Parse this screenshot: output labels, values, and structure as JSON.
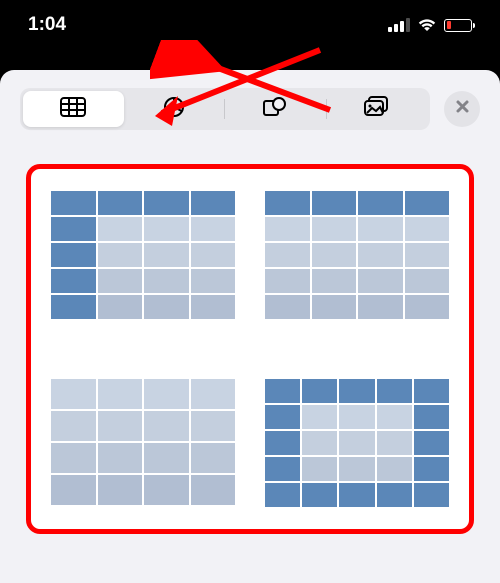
{
  "status": {
    "time": "1:04"
  },
  "tabs": {
    "table": "table-icon",
    "chart": "pie-chart-icon",
    "shape": "shapes-icon",
    "media": "media-icon"
  },
  "close": "✕",
  "previews": [
    {
      "type": "header-row-and-col",
      "cols": 4
    },
    {
      "type": "header-row",
      "cols": 4
    },
    {
      "type": "plain",
      "cols": 4
    },
    {
      "type": "header-all-borders",
      "cols": 5
    }
  ]
}
